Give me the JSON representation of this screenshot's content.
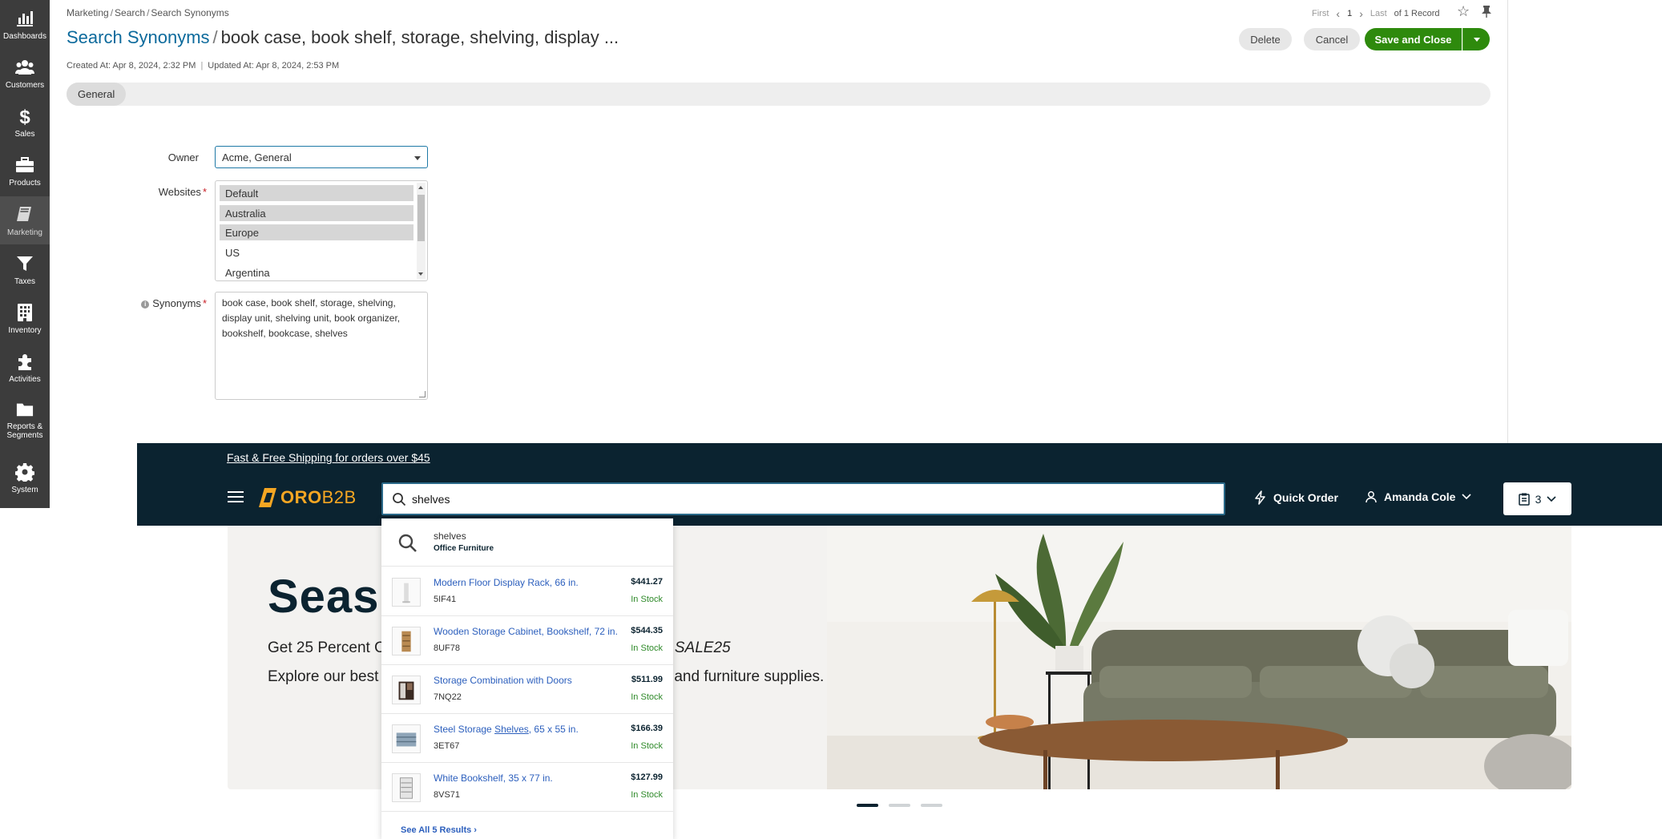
{
  "sidebar": {
    "items": [
      {
        "label": "Dashboards",
        "icon": "bar-chart-icon"
      },
      {
        "label": "Customers",
        "icon": "users-icon"
      },
      {
        "label": "Sales",
        "icon": "dollar-icon"
      },
      {
        "label": "Products",
        "icon": "briefcase-icon"
      },
      {
        "label": "Marketing",
        "icon": "book-icon"
      },
      {
        "label": "Taxes",
        "icon": "filter-icon"
      },
      {
        "label": "Inventory",
        "icon": "building-icon"
      },
      {
        "label": "Activities",
        "icon": "puzzle-icon"
      },
      {
        "label": "Reports &",
        "label2": "Segments",
        "icon": "folder-icon"
      },
      {
        "label": "System",
        "icon": "gear-icon"
      }
    ]
  },
  "breadcrumb": {
    "a": "Marketing",
    "b": "Search",
    "c": "Search Synonyms"
  },
  "title": {
    "entity": "Search Synonyms",
    "record": "book case, book shelf, storage, shelving, display ..."
  },
  "meta": {
    "created": "Created At: Apr 8, 2024, 2:32 PM",
    "updated": "Updated At: Apr 8, 2024, 2:53 PM"
  },
  "pager": {
    "first": "First",
    "page": "1",
    "last": "Last",
    "total": "of 1 Record"
  },
  "actions": {
    "delete": "Delete",
    "cancel": "Cancel",
    "save": "Save and Close"
  },
  "tabs": {
    "general": "General"
  },
  "form": {
    "owner_label": "Owner",
    "owner_value": "Acme, General",
    "websites_label": "Websites",
    "websites": [
      {
        "label": "Default",
        "selected": true
      },
      {
        "label": "Australia",
        "selected": true
      },
      {
        "label": "Europe",
        "selected": true
      },
      {
        "label": "US",
        "selected": false
      },
      {
        "label": "Argentina",
        "selected": false
      }
    ],
    "synonyms_label": "Synonyms",
    "synonyms_value": "book case, book shelf, storage, shelving, display unit, shelving unit, book organizer, bookshelf, bookcase, shelves"
  },
  "store": {
    "promo": "Fast & Free Shipping for orders over $45",
    "logo_a": "ORO",
    "logo_b": "B2B",
    "search_value": "shelves",
    "quick_order": "Quick Order",
    "user": "Amanda Cole",
    "cart_count": "3",
    "hero_title": "Seas",
    "hero_sub1a": "Get 25 Percent O",
    "hero_sub1b": "SALE25",
    "hero_sub2a": "Explore our best",
    "hero_sub2b": "and furniture supplies.",
    "suggestion": {
      "query": "shelves",
      "category": "Office Furniture"
    },
    "results": [
      {
        "name": "Modern Floor Display Rack, 66 in.",
        "sku": "5IF41",
        "price": "$441.27",
        "stock": "In Stock"
      },
      {
        "name": "Wooden Storage Cabinet, Bookshelf, 72 in.",
        "sku": "8UF78",
        "price": "$544.35",
        "stock": "In Stock"
      },
      {
        "name": "Storage Combination with Doors",
        "sku": "7NQ22",
        "price": "$511.99",
        "stock": "In Stock"
      },
      {
        "name_pre": "Steel Storage ",
        "name_hl": "Shelves",
        "name_post": ", 65 x 55 in.",
        "sku": "3ET67",
        "price": "$166.39",
        "stock": "In Stock"
      },
      {
        "name": "White Bookshelf, 35 x 77 in.",
        "sku": "8VS71",
        "price": "$127.99",
        "stock": "In Stock"
      }
    ],
    "see_all": "See All 5 Results ›"
  },
  "colors": {
    "accent": "#0c6a9c",
    "save": "#2e8a0d",
    "store_header": "#0b2330",
    "logo": "#f5a623"
  }
}
